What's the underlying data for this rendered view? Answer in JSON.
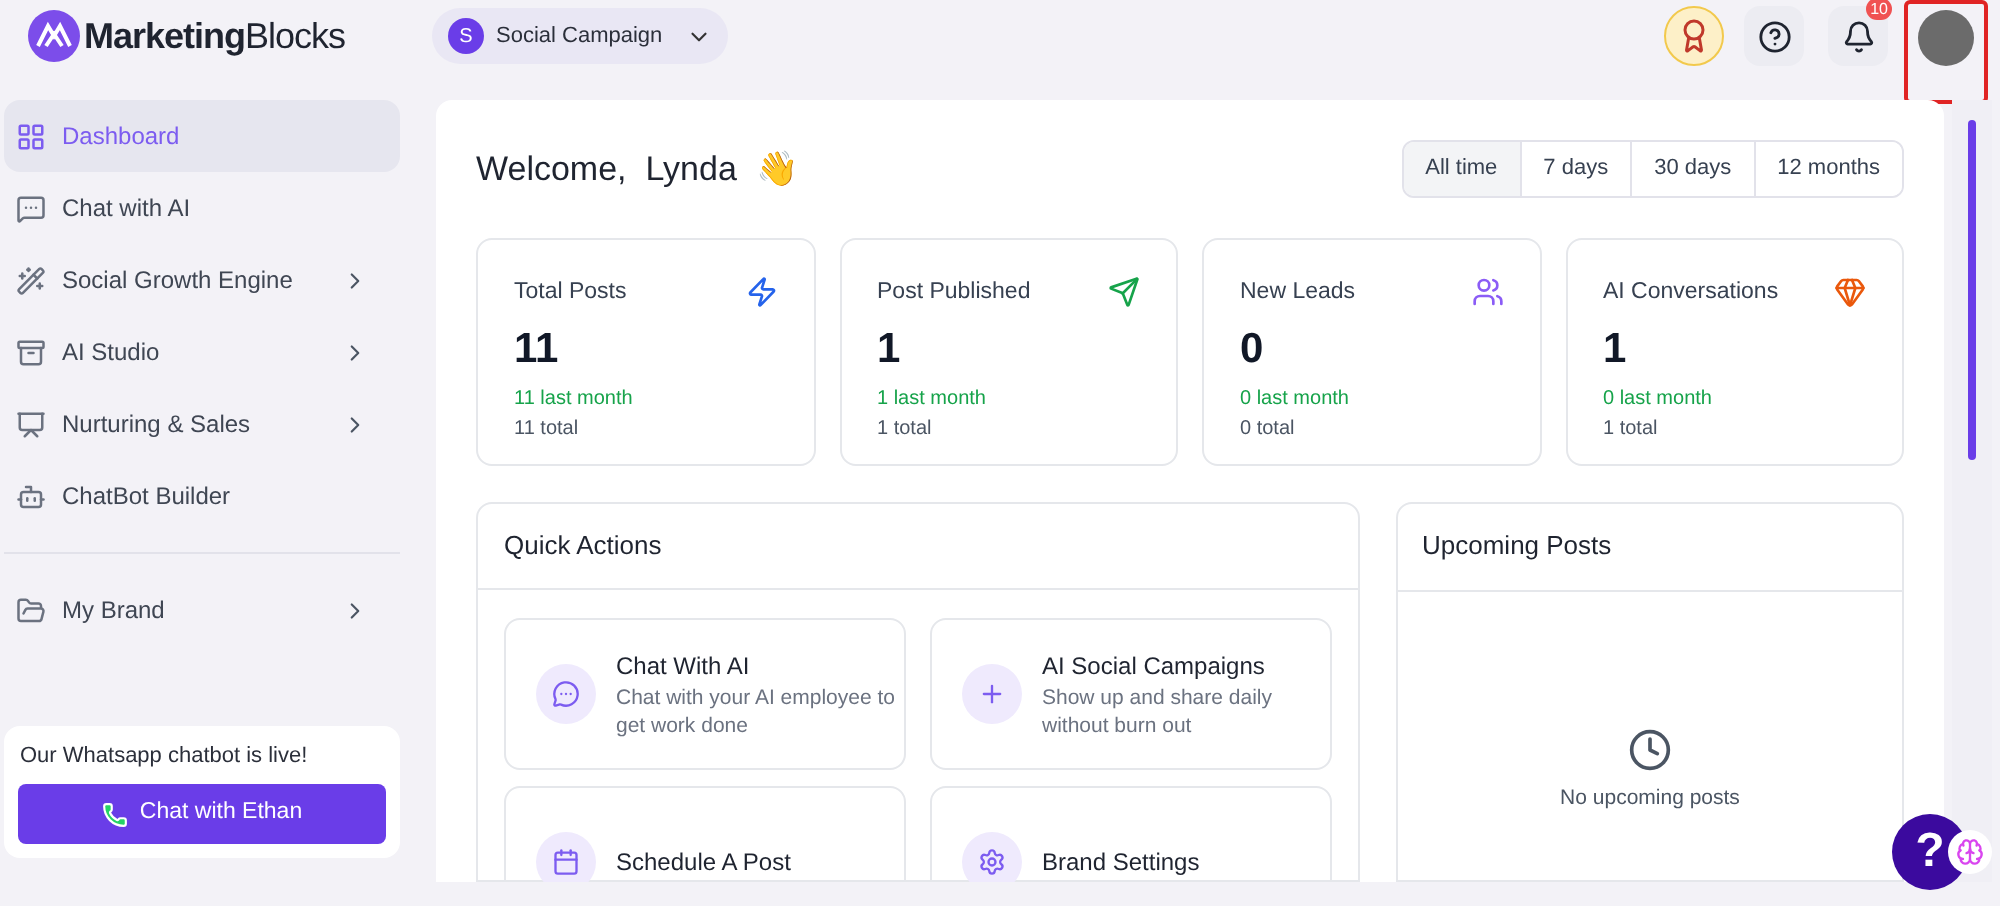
{
  "brand": {
    "name_bold": "Marketing",
    "name_light": "Blocks"
  },
  "workspace": {
    "initial": "S",
    "name": "Social Campaign"
  },
  "header": {
    "notification_count": "10"
  },
  "sidebar": {
    "groups": [
      [
        {
          "label": "Dashboard",
          "selected": true,
          "has_submenu": false
        },
        {
          "label": "Chat with AI",
          "selected": false,
          "has_submenu": false
        },
        {
          "label": "Social Growth Engine",
          "selected": false,
          "has_submenu": true
        },
        {
          "label": "AI Studio",
          "selected": false,
          "has_submenu": true
        },
        {
          "label": "Nurturing & Sales",
          "selected": false,
          "has_submenu": true
        },
        {
          "label": "ChatBot Builder",
          "selected": false,
          "has_submenu": false
        }
      ],
      [
        {
          "label": "My Brand",
          "selected": false,
          "has_submenu": true
        }
      ]
    ],
    "promo": {
      "text": "Our Whatsapp chatbot is live!",
      "button": "Chat with Ethan"
    }
  },
  "welcome": {
    "greeting": "Welcome,",
    "name": "Lynda",
    "emoji": "👋"
  },
  "time_filters": [
    {
      "label": "All time",
      "selected": true
    },
    {
      "label": "7 days",
      "selected": false
    },
    {
      "label": "30 days",
      "selected": false
    },
    {
      "label": "12 months",
      "selected": false
    }
  ],
  "stats": [
    {
      "title": "Total Posts",
      "value": "11",
      "recent": "11 last month",
      "total": "11 total"
    },
    {
      "title": "Post Published",
      "value": "1",
      "recent": "1 last month",
      "total": "1 total"
    },
    {
      "title": "New Leads",
      "value": "0",
      "recent": "0 last month",
      "total": "0 total"
    },
    {
      "title": "AI Conversations",
      "value": "1",
      "recent": "0 last month",
      "total": "1 total"
    }
  ],
  "quick_actions": {
    "title": "Quick Actions",
    "items": [
      {
        "title": "Chat With AI",
        "description": "Chat with your AI employee to get work done"
      },
      {
        "title": "AI Social Campaigns",
        "description": "Show up and share daily without burn out"
      },
      {
        "title": "Schedule A Post"
      },
      {
        "title": "Brand Settings"
      }
    ]
  },
  "upcoming_posts": {
    "title": "Upcoming Posts",
    "empty_text": "No upcoming posts"
  },
  "help_button": {
    "label": "?"
  }
}
